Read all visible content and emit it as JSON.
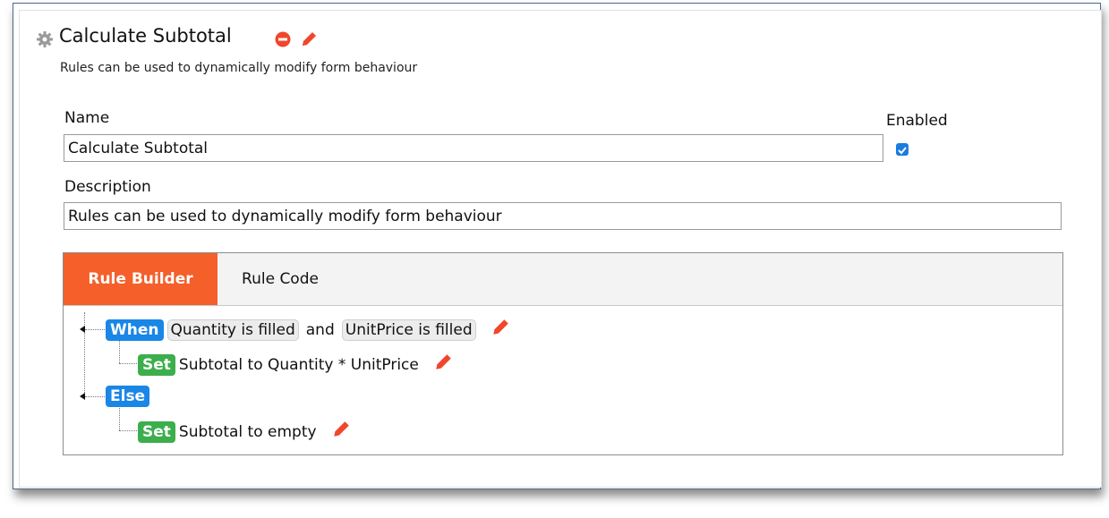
{
  "header": {
    "title": "Calculate Subtotal",
    "subtitle": "Rules can be used to dynamically modify form behaviour",
    "icons": [
      "gear-icon",
      "remove-icon",
      "edit-pencil-icon"
    ]
  },
  "form": {
    "name_label": "Name",
    "name_value": "Calculate Subtotal",
    "enabled_label": "Enabled",
    "enabled_checked": true,
    "description_label": "Description",
    "description_value": "Rules can be used to dynamically modify form behaviour"
  },
  "tabs": [
    {
      "label": "Rule Builder",
      "active": true
    },
    {
      "label": "Rule Code",
      "active": false
    }
  ],
  "rules": {
    "when": {
      "keyword": "When",
      "cond1": "Quantity is filled",
      "joiner": "and",
      "cond2": "UnitPrice is filled"
    },
    "when_action": {
      "keyword": "Set",
      "text": "Subtotal to Quantity * UnitPrice"
    },
    "else": {
      "keyword": "Else"
    },
    "else_action": {
      "keyword": "Set",
      "text": "Subtotal to empty"
    }
  },
  "colors": {
    "accent_orange": "#f45f2a",
    "keyword_blue": "#1a86e6",
    "keyword_green": "#3cae4c",
    "checkbox_blue": "#1a7ce0",
    "remove_red": "#f0462c",
    "pencil_red": "#f0462c"
  }
}
